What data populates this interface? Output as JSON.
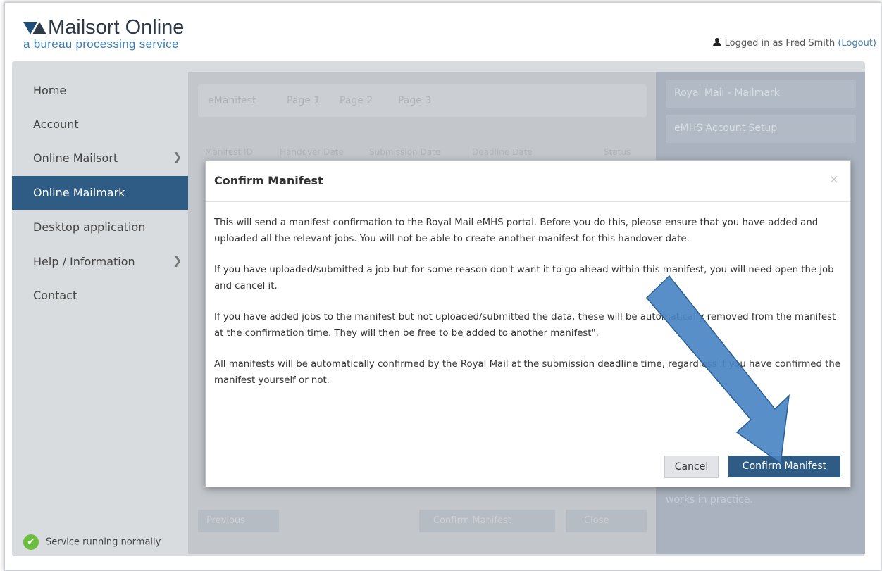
{
  "header": {
    "logo_title": "Mailsort Online",
    "logo_subtitle": "a bureau processing service",
    "logged_in_text": "Logged in as Fred Smith",
    "logout_label": "(Logout)"
  },
  "sidebar": {
    "items": [
      {
        "label": "Home"
      },
      {
        "label": "Account"
      },
      {
        "label": "Online Mailsort"
      },
      {
        "label": "Online Mailmark"
      },
      {
        "label": "Desktop application"
      },
      {
        "label": "Help / Information"
      },
      {
        "label": "Contact"
      }
    ],
    "active": "Online Mailmark",
    "status_text": "Service running normally"
  },
  "background_page": {
    "tabs": [
      "eManifest",
      "Page 1",
      "Page 2",
      "Page 3"
    ],
    "columns": [
      "Manifest ID",
      "Handover Date",
      "Submission Date",
      "Deadline Date",
      "Status"
    ],
    "previous_label": "Previous",
    "confirm_label": "Confirm Manifest",
    "close_label": "Close",
    "right_items": [
      "Royal Mail - Mailmark",
      "eMHS Account Setup"
    ],
    "right_text": "works in practice."
  },
  "modal": {
    "title": "Confirm Manifest",
    "close_icon": "×",
    "paragraphs": [
      "This will send a manifest confirmation to the Royal Mail eMHS portal. Before you do this, please ensure that you have added and uploaded all the relevant jobs. You will not be able to create another manifest for this handover date.",
      "If you have uploaded/submitted a job but for some reason don't want it to go ahead within this manifest, you will need open the job and cancel it.",
      "If you have added jobs to the manifest but not uploaded/submitted the data, these will be automatically removed from the manifest at the confirmation time. They will then be free to be added to another manifest\".",
      "All manifests will be automatically confirmed by the Royal Mail at the submission deadline time, regardless if you have confirmed the manifest yourself or not."
    ],
    "cancel_label": "Cancel",
    "confirm_label": "Confirm Manifest"
  },
  "colors": {
    "accent": "#2f5c85",
    "arrow": "#4a86c4"
  }
}
